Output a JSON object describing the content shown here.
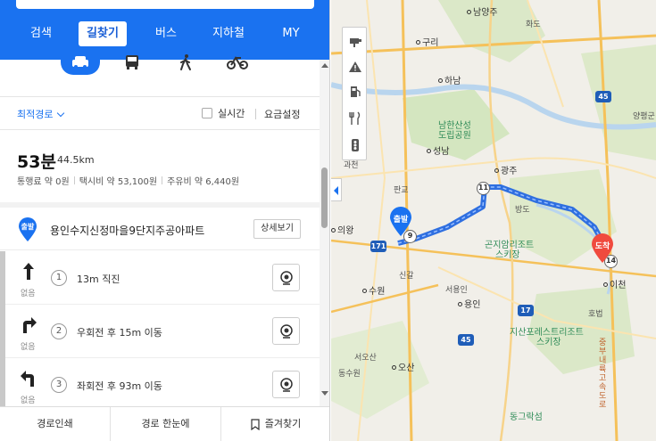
{
  "nav": {
    "tabs": [
      {
        "label": "검색"
      },
      {
        "label": "길찾기"
      },
      {
        "label": "버스"
      },
      {
        "label": "지하철"
      },
      {
        "label": "MY"
      }
    ],
    "active_tab": "길찾기"
  },
  "modes": [
    "car-icon",
    "bus-icon",
    "walk-icon",
    "bike-icon"
  ],
  "route_options": {
    "best": "최적경로",
    "realtime": "실시간",
    "fare": "요금설정"
  },
  "summary": {
    "time": "53분",
    "distance": "44.5km",
    "toll": "통행료 약 0원",
    "taxi": "택시비 약 53,100원",
    "fuel": "주유비 약 6,440원"
  },
  "origin": {
    "pin_label": "출발",
    "name": "용인수지신정마을9단지주공아파트",
    "detail_button": "상세보기"
  },
  "steps": [
    {
      "num": "1",
      "text": "13m 직진",
      "icon": "straight-arrow-icon",
      "sub": "없음"
    },
    {
      "num": "2",
      "text": "우회전 후 15m 이동",
      "icon": "right-turn-arrow-icon",
      "sub": "없음"
    },
    {
      "num": "3",
      "text": "좌회전 후 93m 이동",
      "icon": "left-turn-arrow-icon",
      "sub": "없음"
    }
  ],
  "bottom": {
    "print": "경로인쇄",
    "overview": "경로 한눈에",
    "bookmark": "즐겨찾기"
  },
  "map": {
    "labels": {
      "namyangju": "남양주",
      "hwado": "화도",
      "guri": "구리",
      "hanam": "하남",
      "namhansan": "남한산성",
      "dorip": "도립공원",
      "seongnam": "성남",
      "gwangju": "광주",
      "pangyo": "판교",
      "uiwang": "의왕",
      "suwon": "수원",
      "singal": "신갈",
      "seoyongin": "서용인",
      "yongin": "용인",
      "osan": "오산",
      "seoosan": "서오산",
      "icheon": "이천",
      "hobeop": "호법",
      "yangpyeong": "양평군",
      "gonjiam": "곤지암리조트",
      "gonjiam_ski": "스키장",
      "jisan": "지산포레스트리조트",
      "jisan_ski": "스키장",
      "donggeurak": "동그락섬",
      "bangdo": "방도",
      "gwacheon": "과천",
      "expressway": "중부내륙고속도로",
      "dongsuwon": "동수원"
    },
    "start_label": "출발",
    "end_label": "도착",
    "hwy_45_top": "45",
    "hwy_45_bottom": "45",
    "hwy_17": "17",
    "hwy_171": "171",
    "circle_9": "9",
    "circle_11": "11",
    "circle_14": "14",
    "colors": {
      "route": "#2f6fe0",
      "start": "#1a72f0",
      "end": "#f04a3e"
    }
  }
}
